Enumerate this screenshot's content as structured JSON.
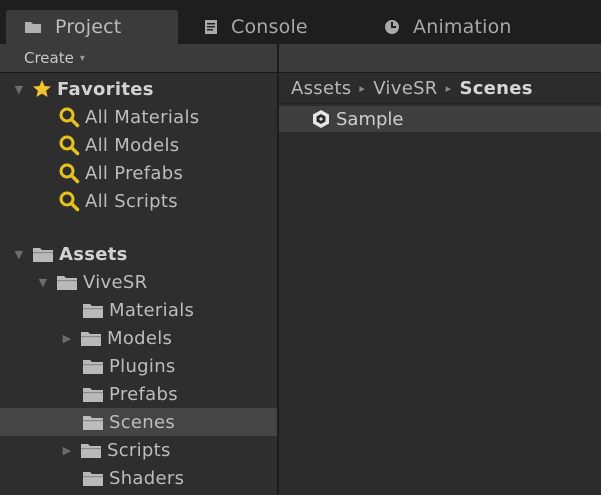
{
  "tabs": [
    {
      "label": "Project",
      "icon": "folder-icon",
      "active": true
    },
    {
      "label": "Console",
      "icon": "console-icon",
      "active": false
    },
    {
      "label": "Animation",
      "icon": "clock-icon",
      "active": false
    }
  ],
  "toolbar": {
    "create_label": "Create",
    "create_caret": "▾"
  },
  "tree": {
    "favorites": {
      "label": "Favorites",
      "items": [
        "All Materials",
        "All Models",
        "All Prefabs",
        "All Scripts"
      ]
    },
    "assets": {
      "label": "Assets",
      "vivesr": {
        "label": "ViveSR",
        "children": [
          {
            "label": "Materials",
            "has_children": false
          },
          {
            "label": "Models",
            "has_children": true
          },
          {
            "label": "Plugins",
            "has_children": false
          },
          {
            "label": "Prefabs",
            "has_children": false
          },
          {
            "label": "Scenes",
            "has_children": false,
            "selected": true
          },
          {
            "label": "Scripts",
            "has_children": true
          },
          {
            "label": "Shaders",
            "has_children": false
          }
        ]
      }
    }
  },
  "breadcrumb": {
    "parts": [
      "Assets",
      "ViveSR",
      "Scenes"
    ],
    "separator": "▸"
  },
  "assets_list": [
    {
      "name": "Sample",
      "icon": "unity-scene-icon"
    }
  ],
  "colors": {
    "favorite_star": "#f2c230",
    "search_icon": "#e8c21c",
    "selection": "#454545",
    "folder": "#b9b9b9"
  }
}
